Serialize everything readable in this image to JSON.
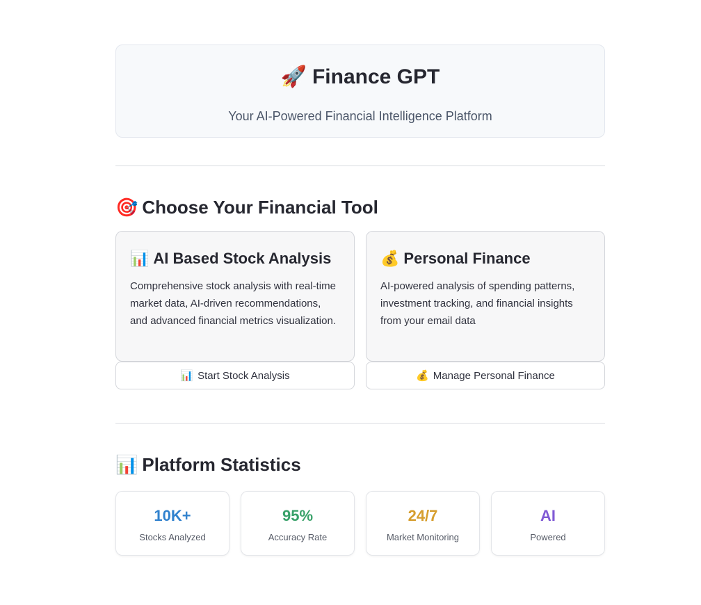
{
  "hero": {
    "icon": "rocket-icon",
    "icon_glyph": "🚀",
    "title": "Finance GPT",
    "subtitle": "Your AI-Powered Financial Intelligence Platform"
  },
  "tools_section": {
    "icon": "target-icon",
    "icon_glyph": "🎯",
    "title": "Choose Your Financial Tool"
  },
  "tools": [
    {
      "icon": "bar-chart-icon",
      "icon_glyph": "📊",
      "title": "AI Based Stock Analysis",
      "description": "Comprehensive stock analysis with real-time market data, AI-driven recommendations, and advanced financial metrics visualization.",
      "button_icon_glyph": "📊",
      "button_label": "Start Stock Analysis"
    },
    {
      "icon": "money-bag-icon",
      "icon_glyph": "💰",
      "title": "Personal Finance",
      "description": "AI-powered analysis of spending patterns, investment tracking, and financial insights from your email data",
      "button_icon_glyph": "💰",
      "button_label": "Manage Personal Finance"
    }
  ],
  "stats_section": {
    "icon": "bar-chart-icon",
    "icon_glyph": "📊",
    "title": "Platform Statistics"
  },
  "stats": [
    {
      "value": "10K+",
      "label": "Stocks Analyzed",
      "color": "#3182ce"
    },
    {
      "value": "95%",
      "label": "Accuracy Rate",
      "color": "#38a169"
    },
    {
      "value": "24/7",
      "label": "Market Monitoring",
      "color": "#d69e2e"
    },
    {
      "value": "AI",
      "label": "Powered",
      "color": "#805ad5"
    }
  ]
}
